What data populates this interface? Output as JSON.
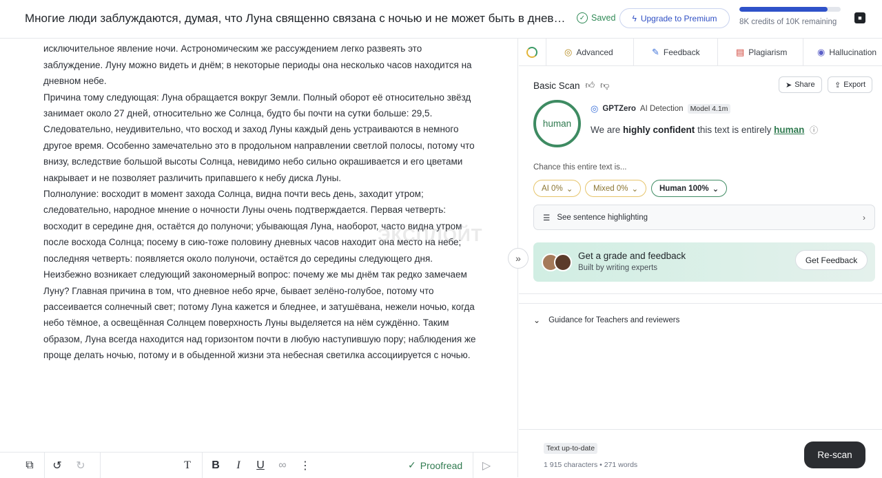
{
  "header": {
    "doc_title": "Многие люди заблуждаются, думая, что Луна священно связана с ночью и не может быть в дневное время…",
    "saved_label": "Saved",
    "upgrade_label": "Upgrade to Premium",
    "credits_text": "8K credits of 10K remaining",
    "credits_used_fraction": 0.87
  },
  "editor": {
    "paragraphs": [
      "незамедлительно появляется после Солнца, и потому мы склонны полагать, что Луна, исключительное явление ночи. Астрономическим же рассуждением легко развеять это заблуждение. Луну можно видеть и днём; в некоторые периоды она несколько часов находится на дневном небе.",
      "Причина тому следующая: Луна обращается вокруг Земли. Полный оборот её относительно звёзд занимает около 27 дней, относительно же Солнца, будто бы почти на сутки больше: 29,5. Следовательно, неудивительно, что восход и заход Луны каждый день устраиваются в немного другое время. Особенно замечательно это в продольном направлении светлой полосы, потому что внизу, вследствие большой высоты Солнца, невидимо небо сильно окрашивается и его цветами накрывает и не позволяет различить припавшего к небу диска Луны.",
      "Полнолуние: восходит в момент захода Солнца, видна почти весь день, заходит утром; следовательно, народное мнение о ночности Луны очень подтверждается. Первая четверть: восходит в середине дня, остаётся до полуночи; убывающая Луна, наоборот, часто видна утром после восхода Солнца; посему в сию-тоже половину дневных часов находит она место на небе; последняя четверть: появляется около полуночи, остаётся до середины следующего дня.",
      "Неизбежно возникает следующий закономерный вопрос: почему же мы днём так редко замечаем Луну? Главная причина в том, что дневное небо ярче, бывает зелёно-голубое, потому что рассеивается солнечный свет; потому Луна кажется и бледнее, и затушёвана, нежели ночью, когда небо тёмное, а освещённая Солнцем поверхность Луны выделяется на нём суждённо. Таким образом, Луна всегда находится над горизонтом почти в любую наступившую пору; наблюдения же проще делать ночью, потому и в обыденной жизни эта небесная светилка ассоциируется с ночью."
    ],
    "watermark": "ЭКСПЛОЙТ"
  },
  "toolbar": {
    "proofread_label": "Proofread"
  },
  "panel": {
    "tabs": [
      {
        "label": "Advanced",
        "icon": "target-icon"
      },
      {
        "label": "Feedback",
        "icon": "pen-icon"
      },
      {
        "label": "Plagiarism",
        "icon": "document-icon"
      },
      {
        "label": "Hallucination",
        "icon": "fingerprint-icon"
      }
    ],
    "scan_title": "Basic Scan",
    "share_label": "Share",
    "export_label": "Export",
    "result_label": "human",
    "detector_name": "GPTZero",
    "detector_suffix": "AI Detection",
    "model_badge": "Model 4.1m",
    "confidence": {
      "prefix": "We are",
      "strong": "highly confident",
      "middle": "this text is entirely",
      "verdict": "human"
    },
    "chance_label": "Chance this entire text is...",
    "pills": {
      "ai": "AI 0%",
      "mixed": "Mixed 0%",
      "human": "Human 100%"
    },
    "highlight_label": "See sentence highlighting",
    "feedback_card": {
      "title": "Get a grade and feedback",
      "subtitle": "Built by writing experts",
      "button": "Get Feedback"
    },
    "guidance_label": "Guidance for Teachers and reviewers",
    "footer": {
      "status_badge": "Text up-to-date",
      "counts": "1 915 characters • 271 words",
      "rescan_label": "Re-scan"
    }
  },
  "colors": {
    "human_green": "#3e8b62",
    "mixed_yellow": "#e6c46a",
    "accent_blue": "#2f52c9",
    "dark_button": "#2b2d31"
  }
}
